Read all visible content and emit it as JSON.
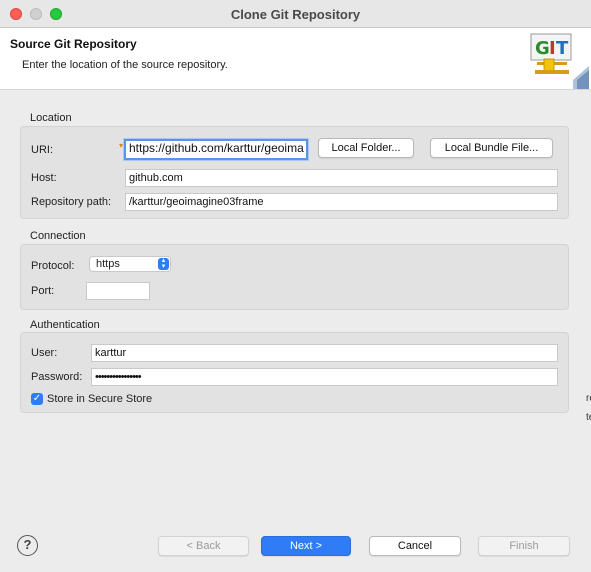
{
  "window": {
    "title": "Clone Git Repository"
  },
  "banner": {
    "title": "Source Git Repository",
    "description": "Enter the location of the source repository.",
    "logo_text": "GIT"
  },
  "location": {
    "group_label": "Location",
    "uri_label": "URI:",
    "uri_value": "https://github.com/karttur/geoima",
    "local_folder_button": "Local Folder...",
    "local_bundle_button": "Local Bundle File...",
    "host_label": "Host:",
    "host_value": "github.com",
    "repo_path_label": "Repository path:",
    "repo_path_value": "/karttur/geoimagine03frame"
  },
  "connection": {
    "group_label": "Connection",
    "protocol_label": "Protocol:",
    "protocol_value": "https",
    "port_label": "Port:",
    "port_value": ""
  },
  "authentication": {
    "group_label": "Authentication",
    "user_label": "User:",
    "user_value": "karttur",
    "password_label": "Password:",
    "password_value": "••••••••••••••••",
    "store_label": "Store in Secure Store",
    "store_checked": true
  },
  "footer": {
    "help": "?",
    "back_button": "< Back",
    "next_button": "Next >",
    "cancel_button": "Cancel",
    "finish_button": "Finish"
  },
  "colors": {
    "accent": "#2f7cf6",
    "close": "#ff5f57",
    "zoom": "#28c840"
  }
}
